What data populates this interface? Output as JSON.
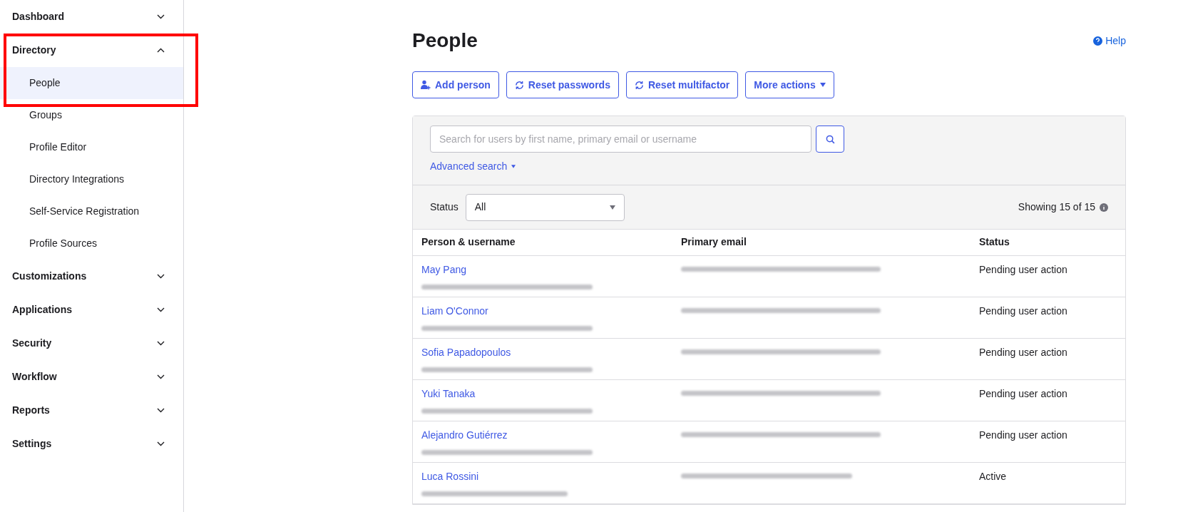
{
  "sidebar": {
    "items": [
      {
        "label": "Dashboard",
        "expanded": false
      },
      {
        "label": "Directory",
        "expanded": true,
        "children": [
          {
            "label": "People",
            "selected": true
          },
          {
            "label": "Groups",
            "selected": false
          },
          {
            "label": "Profile Editor",
            "selected": false
          },
          {
            "label": "Directory Integrations",
            "selected": false
          },
          {
            "label": "Self-Service Registration",
            "selected": false
          },
          {
            "label": "Profile Sources",
            "selected": false
          }
        ]
      },
      {
        "label": "Customizations",
        "expanded": false
      },
      {
        "label": "Applications",
        "expanded": false
      },
      {
        "label": "Security",
        "expanded": false
      },
      {
        "label": "Workflow",
        "expanded": false
      },
      {
        "label": "Reports",
        "expanded": false
      },
      {
        "label": "Settings",
        "expanded": false
      }
    ]
  },
  "page": {
    "title": "People",
    "help": "Help"
  },
  "actions": [
    {
      "kind": "add",
      "label": "Add person"
    },
    {
      "kind": "reset",
      "label": "Reset passwords"
    },
    {
      "kind": "reset",
      "label": "Reset multifactor"
    },
    {
      "kind": "menu",
      "label": "More actions"
    }
  ],
  "search": {
    "placeholder": "Search for users by first name, primary email or username",
    "advanced": "Advanced search"
  },
  "filter": {
    "label": "Status",
    "value": "All",
    "count": "Showing 15 of 15"
  },
  "table": {
    "columns": [
      "Person & username",
      "Primary email",
      "Status"
    ],
    "rows": [
      {
        "name": "May Pang",
        "status": "Pending user action"
      },
      {
        "name": "Liam O'Connor",
        "status": "Pending user action"
      },
      {
        "name": "Sofia Papadopoulos",
        "status": "Pending user action"
      },
      {
        "name": "Yuki Tanaka",
        "status": "Pending user action"
      },
      {
        "name": "Alejandro Gutiérrez",
        "status": "Pending user action"
      },
      {
        "name": "Luca Rossini",
        "status": "Active"
      }
    ]
  }
}
